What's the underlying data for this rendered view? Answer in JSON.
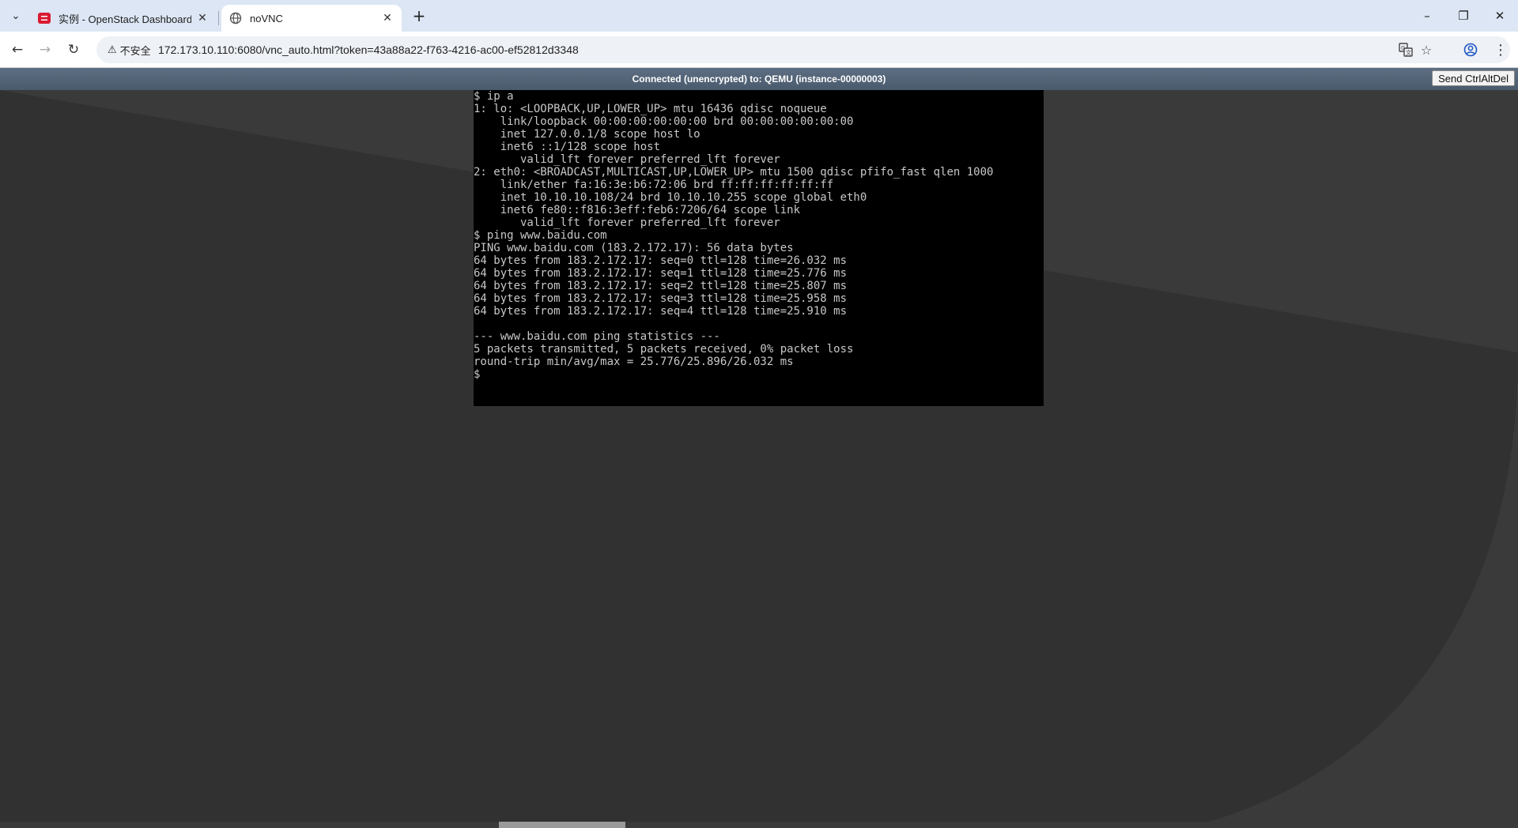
{
  "browser": {
    "tabs": [
      {
        "title": "实例 - OpenStack Dashboard",
        "active": false,
        "icon": "openstack-icon"
      },
      {
        "title": "noVNC",
        "active": true,
        "icon": "globe-icon"
      }
    ],
    "security_label": "不安全",
    "url": "172.173.10.110:6080/vnc_auto.html?token=43a88a22-f763-4216-ac00-ef52812d3348"
  },
  "vnc": {
    "status": "Connected (unencrypted) to: QEMU (instance-00000003)",
    "send_cad_label": "Send CtrlAltDel",
    "terminal_lines": [
      "$ ip a",
      "1: lo: <LOOPBACK,UP,LOWER_UP> mtu 16436 qdisc noqueue",
      "    link/loopback 00:00:00:00:00:00 brd 00:00:00:00:00:00",
      "    inet 127.0.0.1/8 scope host lo",
      "    inet6 ::1/128 scope host",
      "       valid_lft forever preferred_lft forever",
      "2: eth0: <BROADCAST,MULTICAST,UP,LOWER_UP> mtu 1500 qdisc pfifo_fast qlen 1000",
      "    link/ether fa:16:3e:b6:72:06 brd ff:ff:ff:ff:ff:ff",
      "    inet 10.10.10.108/24 brd 10.10.10.255 scope global eth0",
      "    inet6 fe80::f816:3eff:feb6:7206/64 scope link",
      "       valid_lft forever preferred_lft forever",
      "$ ping www.baidu.com",
      "PING www.baidu.com (183.2.172.17): 56 data bytes",
      "64 bytes from 183.2.172.17: seq=0 ttl=128 time=26.032 ms",
      "64 bytes from 183.2.172.17: seq=1 ttl=128 time=25.776 ms",
      "64 bytes from 183.2.172.17: seq=2 ttl=128 time=25.807 ms",
      "64 bytes from 183.2.172.17: seq=3 ttl=128 time=25.958 ms",
      "64 bytes from 183.2.172.17: seq=4 ttl=128 time=25.910 ms",
      "",
      "--- www.baidu.com ping statistics ---",
      "5 packets transmitted, 5 packets received, 0% packet loss",
      "round-trip min/avg/max = 25.776/25.896/26.032 ms",
      "$"
    ]
  },
  "colors": {
    "tabbar_bg": "#dce6f4",
    "status_bar": "#4a5a6d",
    "page_bg": "#313131",
    "openstack_red": "#da1a32"
  }
}
